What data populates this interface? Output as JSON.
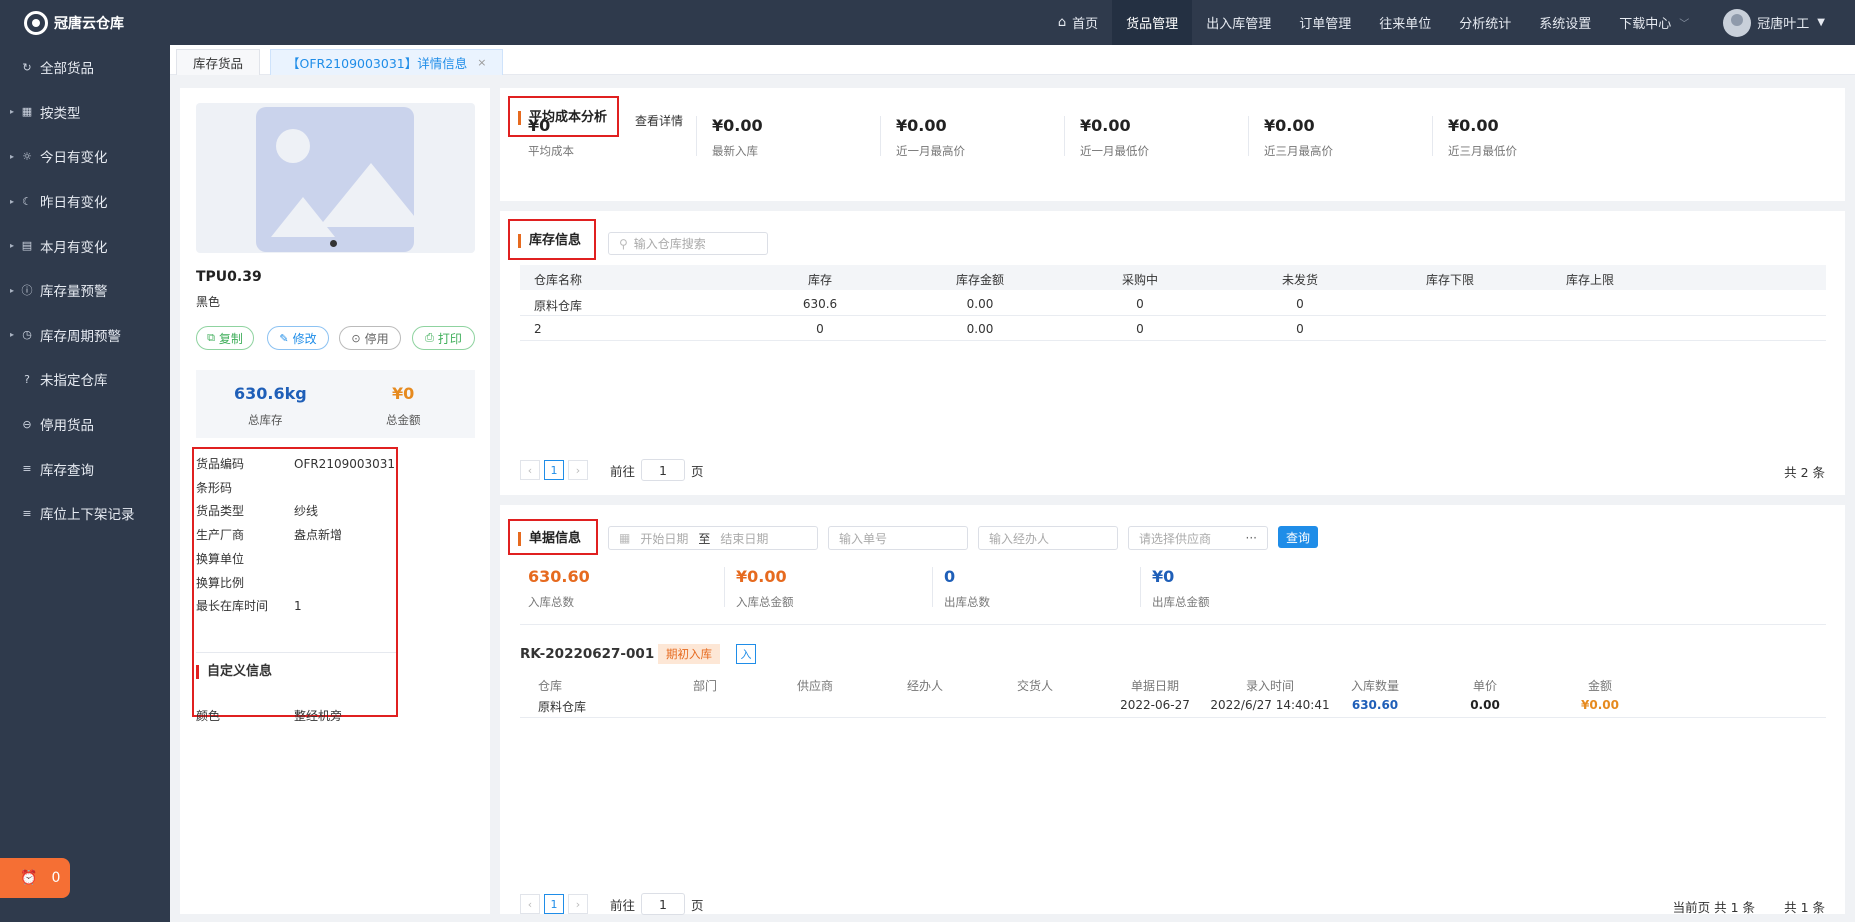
{
  "app": {
    "name": "冠唐云仓库"
  },
  "sidebar": {
    "items": [
      {
        "label": "全部货品",
        "icon": "refresh-icon",
        "arrow": false
      },
      {
        "label": "按类型",
        "icon": "grid-icon",
        "arrow": true
      },
      {
        "label": "今日有变化",
        "icon": "sun-icon",
        "arrow": true
      },
      {
        "label": "昨日有变化",
        "icon": "moon-icon",
        "arrow": true
      },
      {
        "label": "本月有变化",
        "icon": "calendar-icon",
        "arrow": true
      },
      {
        "label": "库存量预警",
        "icon": "alert-icon",
        "arrow": true
      },
      {
        "label": "库存周期预警",
        "icon": "clock-icon",
        "arrow": true
      },
      {
        "label": "未指定仓库",
        "icon": "question-icon",
        "arrow": false
      },
      {
        "label": "停用货品",
        "icon": "minus-circle-icon",
        "arrow": false
      },
      {
        "label": "库存查询",
        "icon": "list-icon",
        "arrow": false
      },
      {
        "label": "库位上下架记录",
        "icon": "list-icon",
        "arrow": false
      }
    ],
    "alarm_count": "0"
  },
  "topbar": {
    "nav": [
      "首页",
      "货品管理",
      "出入库管理",
      "订单管理",
      "往来单位",
      "分析统计",
      "系统设置",
      "下载中心"
    ],
    "active": "货品管理",
    "user": "冠唐叶工"
  },
  "tabs": [
    {
      "label": "库存货品"
    },
    {
      "label": "【OFR2109003031】详情信息",
      "close": "×"
    }
  ],
  "product": {
    "name": "TPU0.39",
    "color": "黑色",
    "actions": {
      "copy": "复制",
      "edit": "修改",
      "disable": "停用",
      "print": "打印"
    },
    "total_stock": "630.6kg",
    "total_stock_label": "总库存",
    "total_amount": "¥0",
    "total_amount_label": "总金额",
    "info": [
      {
        "k": "货品编码",
        "v": "OFR2109003031"
      },
      {
        "k": "条形码",
        "v": ""
      },
      {
        "k": "货品类型",
        "v": "纱线"
      },
      {
        "k": "生产厂商",
        "v": "盎点新增"
      },
      {
        "k": "换算单位",
        "v": ""
      },
      {
        "k": "换算比例",
        "v": ""
      },
      {
        "k": "最长在库时间",
        "v": "1"
      }
    ],
    "custom_title": "自定义信息",
    "custom": [
      {
        "k": "颜色",
        "v": "整经机旁"
      }
    ]
  },
  "cost": {
    "title": "平均成本分析",
    "detail_link": "查看详情",
    "metrics": [
      {
        "v": "¥0",
        "l": "平均成本"
      },
      {
        "v": "¥0.00",
        "l": "最新入库"
      },
      {
        "v": "¥0.00",
        "l": "近一月最高价"
      },
      {
        "v": "¥0.00",
        "l": "近一月最低价"
      },
      {
        "v": "¥0.00",
        "l": "近三月最高价"
      },
      {
        "v": "¥0.00",
        "l": "近三月最低价"
      }
    ]
  },
  "stock": {
    "title": "库存信息",
    "search_placeholder": "输入仓库搜索",
    "columns": [
      "仓库名称",
      "库存",
      "库存金额",
      "采购中",
      "未发货",
      "库存下限",
      "库存上限"
    ],
    "rows": [
      [
        "原料仓库",
        "630.6",
        "0.00",
        "0",
        "0",
        "",
        ""
      ],
      [
        "2",
        "0",
        "0.00",
        "0",
        "0",
        "",
        ""
      ]
    ],
    "pager": {
      "page": "1",
      "goto_label": "前往",
      "page_label": "页",
      "goto_value": "1",
      "total": "共 2 条"
    }
  },
  "docs": {
    "title": "单据信息",
    "start_placeholder": "开始日期",
    "to": "至",
    "end_placeholder": "结束日期",
    "order_placeholder": "输入单号",
    "handler_placeholder": "输入经办人",
    "supplier_placeholder": "请选择供应商",
    "query": "查询",
    "summary": [
      {
        "v": "630.60",
        "l": "入库总数",
        "color": "#e66a1f"
      },
      {
        "v": "¥0.00",
        "l": "入库总金额",
        "color": "#e66a1f"
      },
      {
        "v": "0",
        "l": "出库总数",
        "color": "#1f5fb8"
      },
      {
        "v": "¥0",
        "l": "出库总金额",
        "color": "#1f5fb8"
      }
    ],
    "record": {
      "id": "RK-20220627-001",
      "tag": "期初入库",
      "type_icon": "入",
      "columns": [
        "仓库",
        "部门",
        "供应商",
        "经办人",
        "交货人",
        "单据日期",
        "录入时间",
        "入库数量",
        "单价",
        "金额"
      ],
      "row": [
        "原料仓库",
        "",
        "",
        "",
        "",
        "2022-06-27",
        "2022/6/27 14:40:41",
        "630.60",
        "0.00",
        "¥0.00"
      ]
    },
    "pager": {
      "page": "1",
      "goto_label": "前往",
      "page_label": "页",
      "goto_value": "1",
      "current": "当前页 共 1 条",
      "total": "共 1 条"
    }
  }
}
